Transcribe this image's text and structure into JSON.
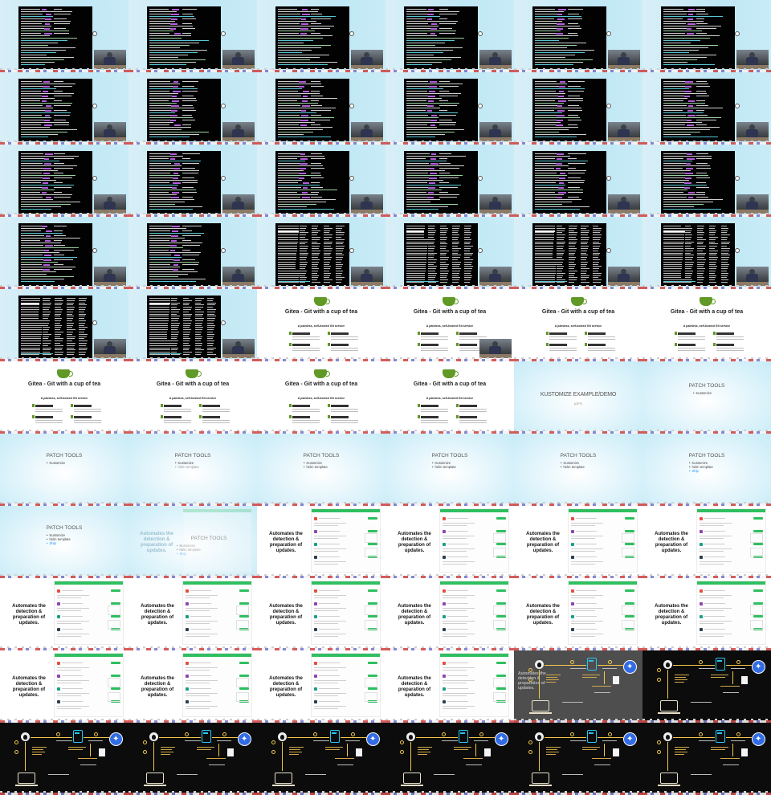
{
  "screen": {
    "columns": 6,
    "rows": 11,
    "layout": "grid of slide/video thumbnails"
  },
  "palette": {
    "terminal_bg": "#020202",
    "terminal_purple": "#b65bdc",
    "gitea_green": "#609926",
    "renovate_green": "#2fbf60",
    "slide_blue": "#c7ebf7",
    "diagram_yellow": "#f2c94c",
    "k8s_blue": "#326ce5",
    "highlight_blue": "#1e90ff"
  },
  "texts": {
    "gitea_title": "Gitea - Git with a cup of tea",
    "gitea_subtitle": "A painless, self-hosted Git service",
    "kustomize_title": "KUSTOMIZE EXAMPLE/DEMO",
    "kustomize_sub": "(OFF)",
    "patch_title": "PATCH TOOLS",
    "patch_items": [
      "Kustomize",
      "helm template",
      "Ship"
    ],
    "renovate_text": "Automates the detection & preparation of updates."
  },
  "frames": [
    {
      "kind": "terminal",
      "variant": "a"
    },
    {
      "kind": "terminal",
      "variant": "a"
    },
    {
      "kind": "terminal",
      "variant": "a"
    },
    {
      "kind": "terminal",
      "variant": "a"
    },
    {
      "kind": "terminal",
      "variant": "a"
    },
    {
      "kind": "terminal",
      "variant": "a"
    },
    {
      "kind": "terminal",
      "variant": "b"
    },
    {
      "kind": "terminal",
      "variant": "b"
    },
    {
      "kind": "terminal",
      "variant": "b"
    },
    {
      "kind": "terminal",
      "variant": "b"
    },
    {
      "kind": "terminal",
      "variant": "b"
    },
    {
      "kind": "terminal",
      "variant": "b"
    },
    {
      "kind": "terminal",
      "variant": "b"
    },
    {
      "kind": "terminal",
      "variant": "b"
    },
    {
      "kind": "terminal",
      "variant": "b"
    },
    {
      "kind": "terminal",
      "variant": "b"
    },
    {
      "kind": "terminal",
      "variant": "b"
    },
    {
      "kind": "terminal",
      "variant": "b"
    },
    {
      "kind": "terminal",
      "variant": "b"
    },
    {
      "kind": "terminal",
      "variant": "b"
    },
    {
      "kind": "terminal",
      "variant": "table"
    },
    {
      "kind": "terminal",
      "variant": "table"
    },
    {
      "kind": "terminal",
      "variant": "table"
    },
    {
      "kind": "terminal",
      "variant": "table"
    },
    {
      "kind": "terminal",
      "variant": "table"
    },
    {
      "kind": "terminal",
      "variant": "table"
    },
    {
      "kind": "gitea",
      "pip": false
    },
    {
      "kind": "gitea",
      "pip": true
    },
    {
      "kind": "gitea",
      "pip": false
    },
    {
      "kind": "gitea",
      "pip": false
    },
    {
      "kind": "gitea",
      "pip": false
    },
    {
      "kind": "gitea",
      "pip": false
    },
    {
      "kind": "gitea",
      "pip": false
    },
    {
      "kind": "gitea",
      "pip": false
    },
    {
      "kind": "kustomize"
    },
    {
      "kind": "patch",
      "items": 1,
      "top": true
    },
    {
      "kind": "patch",
      "items": 1
    },
    {
      "kind": "patch",
      "items": 2,
      "fade": true
    },
    {
      "kind": "patch",
      "items": 2
    },
    {
      "kind": "patch",
      "items": 2
    },
    {
      "kind": "patch",
      "items": 2
    },
    {
      "kind": "patch",
      "items": 3,
      "hl": true
    },
    {
      "kind": "patch",
      "items": 3,
      "hl": true
    },
    {
      "kind": "transition"
    },
    {
      "kind": "renovate"
    },
    {
      "kind": "renovate"
    },
    {
      "kind": "renovate"
    },
    {
      "kind": "renovate"
    },
    {
      "kind": "renovate"
    },
    {
      "kind": "renovate"
    },
    {
      "kind": "renovate"
    },
    {
      "kind": "renovate"
    },
    {
      "kind": "renovate"
    },
    {
      "kind": "renovate"
    },
    {
      "kind": "renovate"
    },
    {
      "kind": "renovate"
    },
    {
      "kind": "renovate"
    },
    {
      "kind": "renovate"
    },
    {
      "kind": "diagram",
      "grey": true
    },
    {
      "kind": "diagram"
    },
    {
      "kind": "diagram"
    },
    {
      "kind": "diagram"
    },
    {
      "kind": "diagram"
    },
    {
      "kind": "diagram"
    },
    {
      "kind": "diagram"
    },
    {
      "kind": "diagram"
    }
  ]
}
